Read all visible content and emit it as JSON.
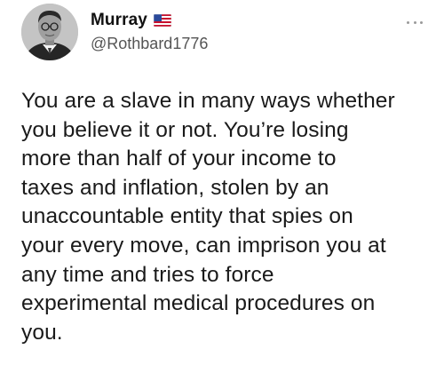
{
  "tweet": {
    "author": {
      "display_name": "Murray",
      "handle": "@Rothbard1776",
      "avatar": "avatar-portrait",
      "flag_icon": "us-flag-icon"
    },
    "more_icon": "more-options-icon",
    "text": "You are a slave in many ways whether\nyou believe it or not. You’re losing\nmore than half of your income to\ntaxes and inflation, stolen by an\nunaccountable entity that spies on\nyour every move, can imprison you at\nany time and tries to force\nexperimental medical procedures on\nyou."
  },
  "colors": {
    "background": "#ffffff",
    "text": "#1a1a1a",
    "handle": "#555555",
    "icon": "#9a9a9a"
  }
}
